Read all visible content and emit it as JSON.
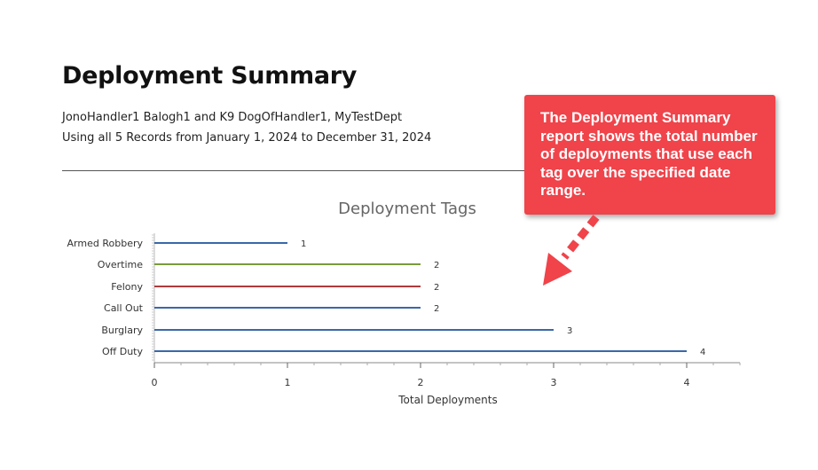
{
  "report": {
    "title": "Deployment Summary",
    "subtitle_line1": "JonoHandler1 Balogh1 and K9 DogOfHandler1, MyTestDept",
    "subtitle_line2": "Using all 5 Records from January 1, 2024 to December 31, 2024"
  },
  "callout": {
    "text": "The Deployment Summary report shows the total number of deployments that use each tag over the specified date range.",
    "background": "#f0434a"
  },
  "chart_data": {
    "type": "bar",
    "orientation": "horizontal",
    "title": "Deployment Tags",
    "xlabel": "Total Deployments",
    "ylabel": "",
    "categories": [
      "Armed Robbery",
      "Overtime",
      "Felony",
      "Call Out",
      "Burglary",
      "Off Duty"
    ],
    "values": [
      1,
      2,
      2,
      2,
      3,
      4
    ],
    "colors": [
      "#3a68a8",
      "#7a9a3a",
      "#b03a3a",
      "#3a68a8",
      "#3a68a8",
      "#3a68a8"
    ],
    "xlim": [
      0,
      4.4
    ],
    "xticks": [
      0,
      1,
      2,
      3,
      4
    ],
    "data_labels": true,
    "grid": false,
    "legend": "none"
  }
}
